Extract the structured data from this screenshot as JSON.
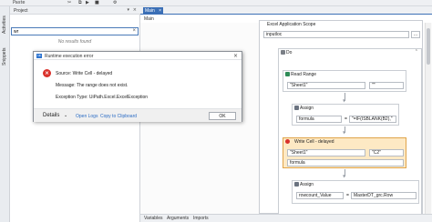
{
  "topbar": {
    "labels": [
      "Paste",
      "",
      "",
      "",
      "",
      ""
    ],
    "icons": [
      "cut-icon",
      "copy-icon",
      "play-icon",
      "stop-icon",
      "settings-icon"
    ]
  },
  "activity_strip": {
    "activities": "Activities",
    "snippets": "Snippets"
  },
  "project": {
    "title": "Project",
    "search_value": "wr",
    "no_results": "No results found"
  },
  "designer": {
    "tab": "Main",
    "breadcrumb": "Main",
    "bottom_tabs": [
      "Variables",
      "Arguments",
      "Imports"
    ]
  },
  "workflow": {
    "scope": {
      "title": "Excel Application Scope",
      "path": "inputloc"
    },
    "do": {
      "title": "Do"
    },
    "read_range": {
      "title": "Read Range",
      "sheet": "\"Sheet1\"",
      "range": "\"\""
    },
    "assign1": {
      "title": "Assign",
      "to": "formula",
      "eq": "=",
      "value": "\"=IF(ISBLANK(B2),\""
    },
    "write_cell": {
      "title": "Write Cell - delayed",
      "sheet": "\"Sheet1\"",
      "cell": "\"C2\"",
      "value": "formula"
    },
    "assign2": {
      "title": "Assign",
      "to": "rowcount_Value",
      "eq": "=",
      "value": "MasterDT_grc.Row"
    }
  },
  "dialog": {
    "title": "Runtime execution error",
    "logo": "Ui",
    "source": "Source: Write Cell - delayed",
    "message": "Message: The range does not exist.",
    "exception": "Exception Type: UiPath.Excel.ExcelException",
    "details": "Details",
    "open_logs": "Open Logs",
    "copy_clipboard": "Copy to Clipboard",
    "ok": "OK"
  },
  "colors": {
    "accent": "#3b6fb6",
    "error": "#d9312b",
    "link": "#2b6cc4",
    "activity_green": "#2e8b57"
  }
}
